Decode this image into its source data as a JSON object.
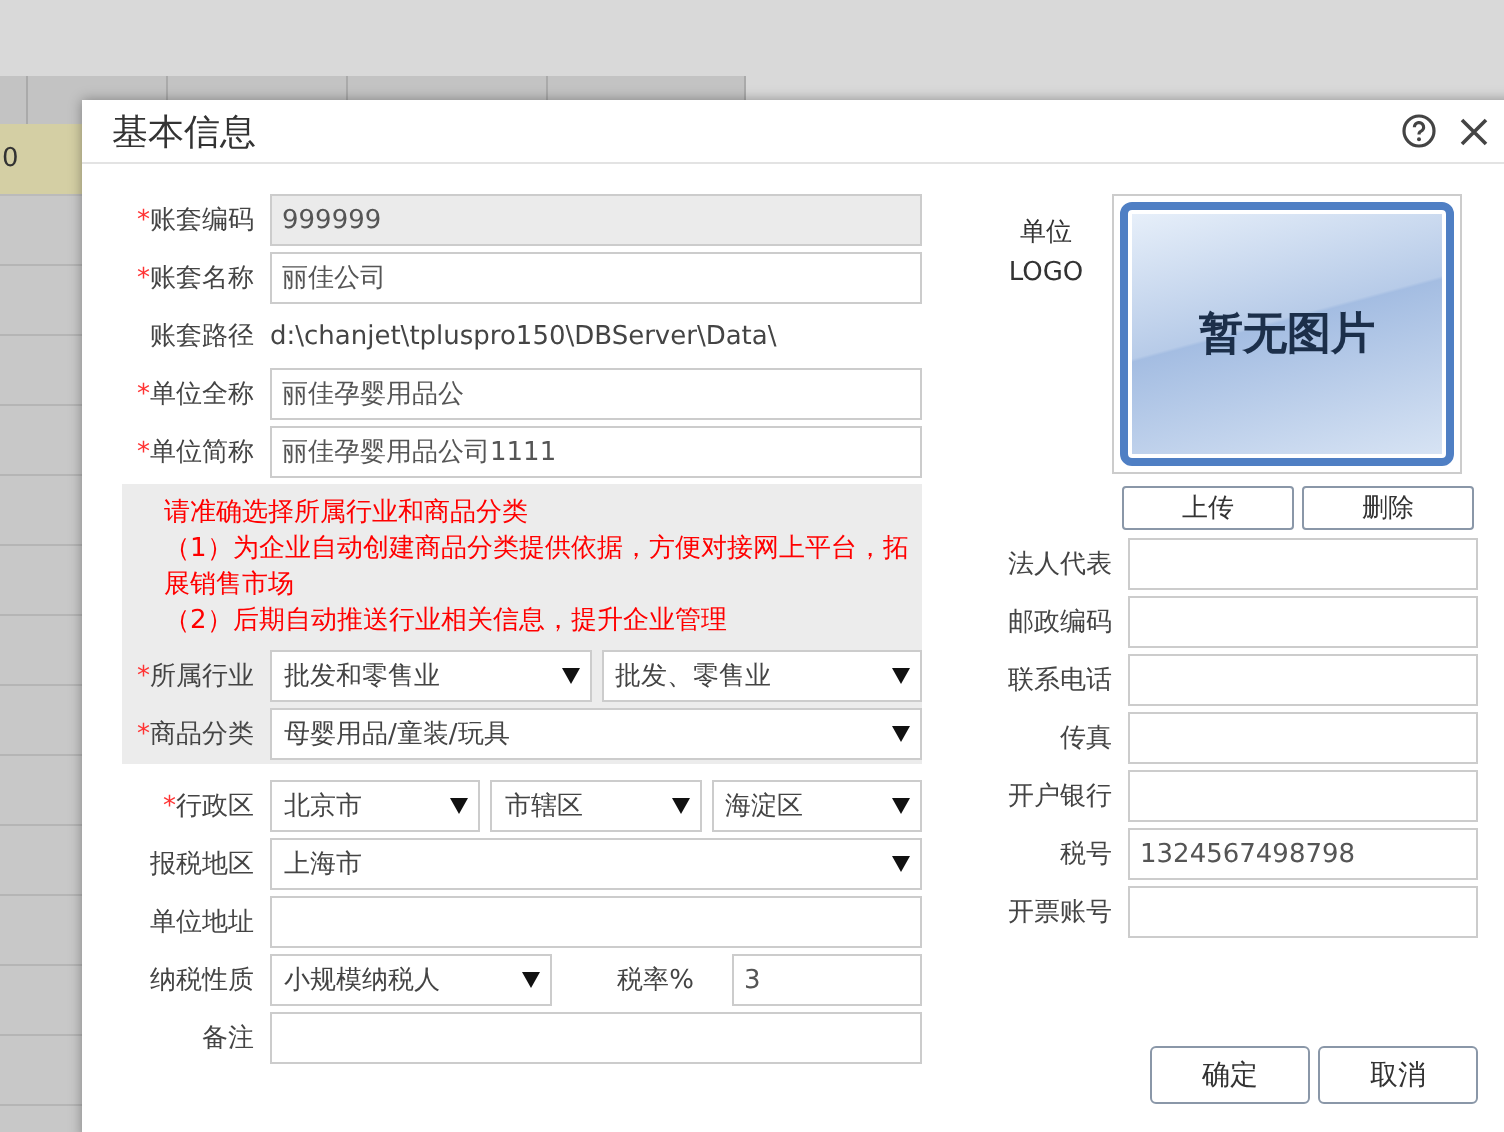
{
  "backdrop": {
    "row_cell": "0"
  },
  "dialog": {
    "title": "基本信息"
  },
  "form_top": [
    {
      "label": "账套编码",
      "required_mark": "*",
      "controls": [
        {
          "kind": "input",
          "value": "999999",
          "disabled": true
        }
      ]
    },
    {
      "label": "账套名称",
      "required_mark": "*",
      "controls": [
        {
          "kind": "input",
          "value": "丽佳公司",
          "disabled": false
        }
      ]
    },
    {
      "label": "账套路径",
      "controls": [
        {
          "kind": "text",
          "value": "d:\\chanjet\\tpluspro150\\DBServer\\Data\\"
        }
      ]
    },
    {
      "label": "单位全称",
      "required_mark": "*",
      "controls": [
        {
          "kind": "input",
          "value": "丽佳孕婴用品公",
          "disabled": false
        }
      ]
    },
    {
      "label": "单位简称",
      "required_mark": "*",
      "controls": [
        {
          "kind": "input",
          "value": "丽佳孕婴用品公司1111",
          "disabled": false
        }
      ]
    }
  ],
  "notice": {
    "lines": [
      "请准确选择所属行业和商品分类",
      "（1）为企业自动创建商品分类提供依据，方便对接网上平台，拓展销售市场",
      "（2）后期自动推送行业相关信息，提升企业管理"
    ],
    "rows": [
      {
        "label": "所属行业",
        "required_mark": "*",
        "controls": [
          {
            "kind": "select",
            "value": "批发和零售业"
          },
          {
            "kind": "select",
            "value": "批发、零售业"
          }
        ]
      },
      {
        "label": "商品分类",
        "required_mark": "*",
        "controls": [
          {
            "kind": "select",
            "value": "母婴用品/童装/玩具"
          }
        ]
      }
    ]
  },
  "form_bottom": [
    {
      "label": "行政区",
      "required_mark": "*",
      "controls": [
        {
          "kind": "select",
          "value": "北京市"
        },
        {
          "kind": "select",
          "value": "市辖区"
        },
        {
          "kind": "select",
          "value": "海淀区"
        }
      ]
    },
    {
      "label": "报税地区",
      "controls": [
        {
          "kind": "select",
          "value": "上海市"
        }
      ]
    },
    {
      "label": "单位地址",
      "controls": [
        {
          "kind": "input",
          "disabled": false
        }
      ]
    },
    {
      "label": "纳税性质",
      "controls": [
        {
          "kind": "select",
          "value": "小规模纳税人"
        },
        {
          "kind": "label",
          "value": "税率%"
        },
        {
          "kind": "input",
          "value": "3",
          "disabled": false
        }
      ]
    },
    {
      "label": "备注",
      "controls": [
        {
          "kind": "input",
          "disabled": false
        }
      ]
    }
  ],
  "logo": {
    "label_lines": [
      "单位",
      "LOGO"
    ],
    "placeholder_text": "暂无图片",
    "buttons": [
      "上传",
      "删除"
    ]
  },
  "form_right": [
    {
      "label": "法人代表"
    },
    {
      "label": "邮政编码"
    },
    {
      "label": "联系电话"
    },
    {
      "label": "传真"
    },
    {
      "label": "开户银行"
    },
    {
      "label": "税号",
      "value": "1324567498798"
    },
    {
      "label": "开票账号"
    }
  ],
  "footer_buttons": [
    "确定",
    "取消"
  ]
}
